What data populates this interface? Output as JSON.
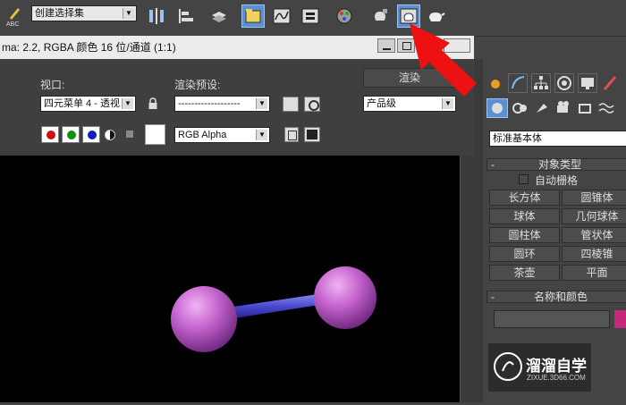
{
  "toolbar": {
    "selection_set": "创建选择集",
    "icons": [
      "abc-spell-icon",
      "mirror-icon",
      "align-icon",
      "layer-manager-icon",
      "scene-explorer-icon",
      "curve-editor-icon",
      "schematic-view-icon",
      "material-editor-icon",
      "render-setup-icon",
      "rendered-frame-window-icon",
      "render-production-icon"
    ]
  },
  "render_window": {
    "title": "ma: 2.2, RGBA 颜色 16 位/通道 (1:1)",
    "viewport_label": "视口:",
    "viewport_value": "四元菜单 4 - 透视",
    "preset_label": "渲染预设:",
    "preset_value": "-------------------",
    "render_button": "渲染",
    "quality_value": "产品级",
    "channel_value": "RGB Alpha",
    "colors": {
      "red": "#d01010",
      "green": "#109010",
      "blue": "#1020c0"
    }
  },
  "panel": {
    "category": "标准基本体",
    "object_type_header": "对象类型",
    "autogrid_label": "自动栅格",
    "buttons": [
      [
        "长方体",
        "圆锥体"
      ],
      [
        "球体",
        "几何球体"
      ],
      [
        "圆柱体",
        "管状体"
      ],
      [
        "圆环",
        "四棱锥"
      ],
      [
        "茶壶",
        "平面"
      ]
    ],
    "name_color_header": "名称和颜色",
    "color_swatch": "#c8287a"
  },
  "watermark": {
    "title": "溜溜自学",
    "url": "ZIXUE.3D66.COM"
  },
  "annotation": {
    "arrow_color": "#ee1111"
  }
}
